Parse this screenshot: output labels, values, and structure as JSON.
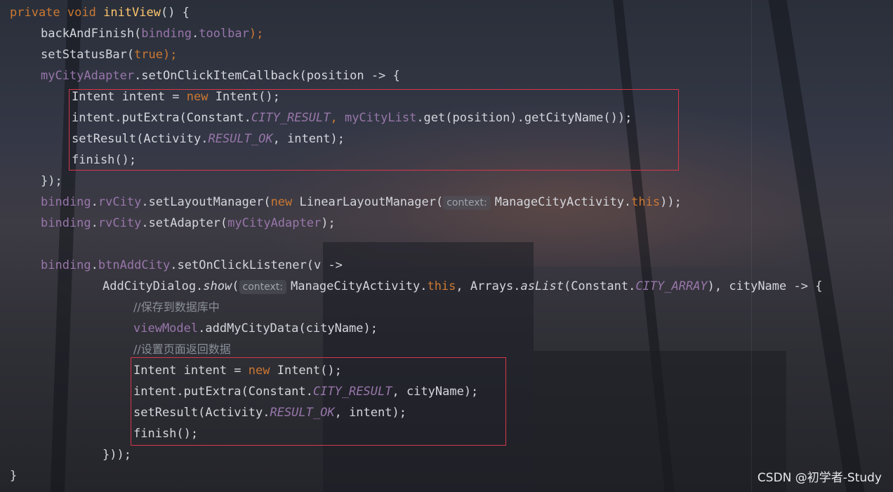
{
  "code": {
    "l1": {
      "a": "private ",
      "b": "void ",
      "c": "initView",
      "d": "() {"
    },
    "l2": {
      "a": "backAndFinish(",
      "b": "binding",
      "c": ".",
      "d": "toolbar",
      "e": ");"
    },
    "l3": {
      "a": "setStatusBar(",
      "b": "true",
      "c": ");"
    },
    "l4": {
      "a": "myCityAdapter",
      "b": ".setOnClickItemCallback(position -> {"
    },
    "l5": {
      "a": "Intent intent = ",
      "b": "new ",
      "c": "Intent();"
    },
    "l6": {
      "a": "intent.putExtra(Constant.",
      "b": "CITY_RESULT",
      "c": ", ",
      "d": "myCityList",
      "e": ".get(position).getCityName());"
    },
    "l7": {
      "a": "setResult(Activity.",
      "b": "RESULT_OK",
      "c": ", intent);"
    },
    "l8": {
      "a": "finish();"
    },
    "l9": {
      "a": "});"
    },
    "l10": {
      "a": "binding",
      "b": ".",
      "c": "rvCity",
      "d": ".setLayoutManager(",
      "e": "new ",
      "f": "LinearLayoutManager(",
      "hint": "context:",
      "g": "ManageCityActivity.",
      "h": "this",
      "i": "));"
    },
    "l11": {
      "a": "binding",
      "b": ".",
      "c": "rvCity",
      "d": ".setAdapter(",
      "e": "myCityAdapter",
      "f": ");"
    },
    "l13": {
      "a": "binding",
      "b": ".",
      "c": "btnAddCity",
      "d": ".setOnClickListener(v ->"
    },
    "l14": {
      "a": "AddCityDialog.",
      "b": "show",
      "c": "(",
      "hint": "context:",
      "d": "ManageCityActivity.",
      "e": "this",
      "f": ", Arrays.",
      "g": "asList",
      "h": "(Constant.",
      "i": "CITY_ARRAY",
      "j": "), cityName -> {"
    },
    "l15": {
      "a": "//保存到数据库中"
    },
    "l16": {
      "a": "viewModel",
      "b": ".addMyCityData(cityName);"
    },
    "l17": {
      "a": "//设置页面返回数据"
    },
    "l18": {
      "a": "Intent intent = ",
      "b": "new ",
      "c": "Intent();"
    },
    "l19": {
      "a": "intent.putExtra(Constant.",
      "b": "CITY_RESULT",
      "c": ", cityName);"
    },
    "l20": {
      "a": "setResult(Activity.",
      "b": "RESULT_OK",
      "c": ", intent);"
    },
    "l21": {
      "a": "finish();"
    },
    "l22": {
      "a": "}));"
    },
    "l23": {
      "a": "}"
    }
  },
  "watermark": "CSDN @初学者-Study",
  "colors": {
    "keyword": "#cc7832",
    "method_decl": "#ffc66d",
    "field": "#9876aa",
    "comment": "#8a8f98",
    "highlight_box": "#d6374a"
  }
}
